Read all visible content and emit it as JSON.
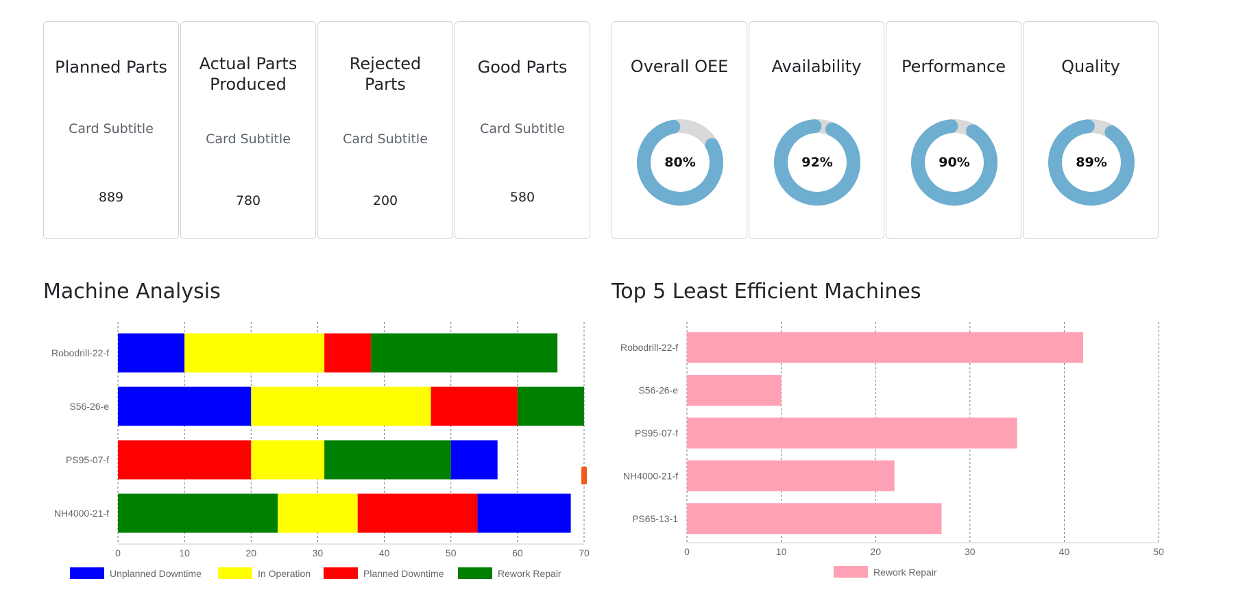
{
  "kpi_cards": [
    {
      "title_lines": [
        "Planned Parts"
      ],
      "subtitle": "Card Subtitle",
      "value": "889"
    },
    {
      "title_lines": [
        "Actual Parts",
        "Produced"
      ],
      "subtitle": "Card Subtitle",
      "value": "780"
    },
    {
      "title_lines": [
        "Rejected",
        "Parts"
      ],
      "subtitle": "Card Subtitle",
      "value": "200"
    },
    {
      "title_lines": [
        "Good Parts"
      ],
      "subtitle": "Card Subtitle",
      "value": "580"
    }
  ],
  "oee_cards": [
    {
      "title": "Overall OEE",
      "value": 80,
      "label": "80%"
    },
    {
      "title": "Availability",
      "value": 92,
      "label": "92%"
    },
    {
      "title": "Performance",
      "value": 90,
      "label": "90%"
    },
    {
      "title": "Quality",
      "value": 89,
      "label": "89%"
    }
  ],
  "colors": {
    "donut_fill": "#6eaed0",
    "donut_track": "#d9d9d9",
    "grid": "#777777",
    "axis_text": "#666666"
  },
  "sections": {
    "machine_analysis_title": "Machine Analysis",
    "least_efficient_title": "Top 5 Least Efficient Machines"
  },
  "chart_data": [
    {
      "type": "bar",
      "orientation": "horizontal",
      "stacked": true,
      "title": "Machine Analysis",
      "categories": [
        "Robodrill-22-f",
        "S56-26-e",
        "PS95-07-f",
        "NH4000-21-f"
      ],
      "xlim": [
        0,
        70
      ],
      "x_ticks": [
        0,
        10,
        20,
        30,
        40,
        50,
        60,
        70
      ],
      "grid": true,
      "legend_position": "bottom",
      "legend": [
        {
          "name": "Unplanned Downtime",
          "color": "#0000ff"
        },
        {
          "name": "In Operation",
          "color": "#ffff00"
        },
        {
          "name": "Planned Downtime",
          "color": "#ff0000"
        },
        {
          "name": "Rework Repair",
          "color": "#008000"
        }
      ],
      "segments": [
        [
          {
            "series": "Unplanned Downtime",
            "value": 10,
            "color": "#0000ff"
          },
          {
            "series": "In Operation",
            "value": 21,
            "color": "#ffff00"
          },
          {
            "series": "Planned Downtime",
            "value": 7,
            "color": "#ff0000"
          },
          {
            "series": "Rework Repair",
            "value": 28,
            "color": "#008000"
          }
        ],
        [
          {
            "series": "Unplanned Downtime",
            "value": 20,
            "color": "#0000ff"
          },
          {
            "series": "In Operation",
            "value": 27,
            "color": "#ffff00"
          },
          {
            "series": "Planned Downtime",
            "value": 13,
            "color": "#ff0000"
          },
          {
            "series": "Rework Repair",
            "value": 10,
            "color": "#008000"
          }
        ],
        [
          {
            "series": "Planned Downtime",
            "value": 20,
            "color": "#ff0000"
          },
          {
            "series": "In Operation",
            "value": 11,
            "color": "#ffff00"
          },
          {
            "series": "Rework Repair",
            "value": 19,
            "color": "#008000"
          },
          {
            "series": "Unplanned Downtime",
            "value": 7,
            "color": "#0000ff"
          }
        ],
        [
          {
            "series": "Rework Repair",
            "value": 24,
            "color": "#008000"
          },
          {
            "series": "In Operation",
            "value": 12,
            "color": "#ffff00"
          },
          {
            "series": "Planned Downtime",
            "value": 18,
            "color": "#ff0000"
          },
          {
            "series": "Unplanned Downtime",
            "value": 14,
            "color": "#0000ff"
          }
        ]
      ],
      "overflow_marker": {
        "row": "PS95-07-f",
        "color": "#f05a1e"
      }
    },
    {
      "type": "bar",
      "orientation": "horizontal",
      "title": "Top 5 Least Efficient Machines",
      "categories": [
        "Robodrill-22-f",
        "S56-26-e",
        "PS95-07-f",
        "NH4000-21-f",
        "PS65-13-1"
      ],
      "series": [
        {
          "name": "Rework Repair",
          "values": [
            42,
            10,
            35,
            22,
            27
          ],
          "color": "#ffa1b5"
        }
      ],
      "xlim": [
        0,
        50
      ],
      "x_ticks": [
        0,
        10,
        20,
        30,
        40,
        50
      ],
      "grid": true,
      "legend_position": "bottom"
    }
  ]
}
